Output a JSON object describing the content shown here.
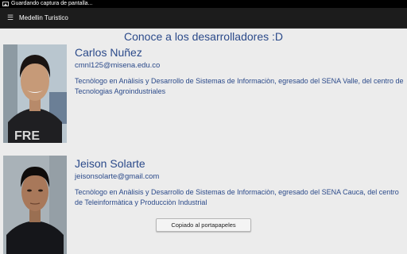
{
  "status_bar": {
    "notification_text": "Guardando captura de pantalla..."
  },
  "action_bar": {
    "title": "Medellin Turistico",
    "menu_icon": "hamburger-icon"
  },
  "heading": "Conoce a los desarrolladores :D",
  "developers": [
    {
      "name": "Carlos Nuñez",
      "email": "cmnl125@misena.edu.co",
      "description": "Tecnòlogo en Anàlisis y Desarrollo de Sistemas de Informaciòn, egresado del SENA Valle, del centro de Tecnologias Agroindustriales"
    },
    {
      "name": "Jeison Solarte",
      "email": "jeisonsolarte@gmail.com",
      "description": "Tecnòlogo en Anàlisis y Desarrollo de Sistemas de Informaciòn, egresado del SENA Cauca, del centro de Teleinformàtica y Producciòn Industrial"
    }
  ],
  "toast": "Copiado al portapapeles"
}
